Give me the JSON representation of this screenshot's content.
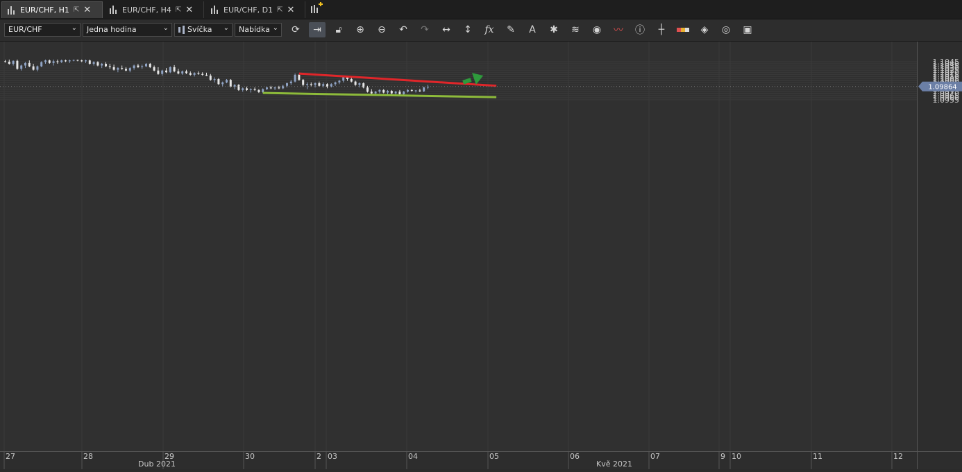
{
  "tabs": [
    {
      "label": "EUR/CHF, H1",
      "active": true
    },
    {
      "label": "EUR/CHF, H4",
      "active": false
    },
    {
      "label": "EUR/CHF, D1",
      "active": false
    }
  ],
  "toolbar": {
    "instrument": "EUR/CHF",
    "period": "Jedna hodina",
    "chart_type": "Svíčka",
    "offer_side": "Nabídka",
    "icons": [
      "refresh-icon",
      "shift-chart-icon",
      "unlock-icon",
      "zoom-in-icon",
      "zoom-out-icon",
      "undo-icon",
      "redo-icon",
      "horizontal-arrows-icon",
      "vertical-arrows-icon",
      "fx-indicators-icon",
      "pencil-draw-icon",
      "text-tool-icon",
      "pattern-icon",
      "layers-icon",
      "eye-icon",
      "chart-signals-icon",
      "info-icon",
      "crosshair-icon",
      "theme-icon",
      "paint-bucket-icon",
      "circular-icon",
      "save-icon"
    ]
  },
  "colors": {
    "background": "#303030",
    "bull_candle": "#8fa3c4",
    "bear_candle": "#e6e6e6",
    "resistance_line": "#e0262a",
    "support_line": "#8dbb3a",
    "arrow": "#2e9a3c",
    "price_marker": "#6b7fa6"
  },
  "price_axis": {
    "labels": [
      "1.1045",
      "1.1040",
      "1.1035",
      "1.1030",
      "1.1025",
      "1.1020",
      "1.1015",
      "1.1010",
      "1.1005",
      "1.1000",
      "1.0995",
      "1.0990",
      "1.0985",
      "1.0980",
      "1.0975",
      "1.0970",
      "1.0965",
      "1.0960",
      "1.0955"
    ],
    "current_price": "1.09864"
  },
  "time_axis": {
    "labels": [
      "27",
      "28",
      "29",
      "30",
      "2",
      "03",
      "04",
      "05",
      "06",
      "07",
      "9",
      "10",
      "11",
      "12"
    ],
    "month_labels": [
      "Dub 2021",
      "Kvě 2021"
    ]
  },
  "chart_data": {
    "type": "candlestick",
    "instrument": "EUR/CHF",
    "period": "H1",
    "ylim": [
      1.095,
      1.105
    ],
    "grid": true,
    "candles": [
      [
        1.1046,
        1.1049,
        1.1043,
        1.1045
      ],
      [
        1.1045,
        1.105,
        1.1038,
        1.104
      ],
      [
        1.104,
        1.1048,
        1.1036,
        1.1047
      ],
      [
        1.1047,
        1.105,
        1.1026,
        1.1028
      ],
      [
        1.1028,
        1.1038,
        1.1024,
        1.1036
      ],
      [
        1.1036,
        1.1044,
        1.103,
        1.1042
      ],
      [
        1.1042,
        1.1048,
        1.1032,
        1.1034
      ],
      [
        1.1034,
        1.104,
        1.1024,
        1.1026
      ],
      [
        1.1026,
        1.1036,
        1.1022,
        1.1034
      ],
      [
        1.1034,
        1.1046,
        1.1032,
        1.1044
      ],
      [
        1.1044,
        1.105,
        1.104,
        1.1048
      ],
      [
        1.1048,
        1.105,
        1.104,
        1.1042
      ],
      [
        1.1042,
        1.105,
        1.1036,
        1.1046
      ],
      [
        1.1046,
        1.105,
        1.104,
        1.1044
      ],
      [
        1.1044,
        1.105,
        1.1042,
        1.1048
      ],
      [
        1.1048,
        1.105,
        1.1044,
        1.1046
      ],
      [
        1.1046,
        1.105,
        1.1042,
        1.1048
      ],
      [
        1.1048,
        1.105,
        1.1046,
        1.1049
      ],
      [
        1.1049,
        1.105,
        1.1046,
        1.1048
      ],
      [
        1.1048,
        1.105,
        1.1044,
        1.1046
      ],
      [
        1.1046,
        1.105,
        1.1042,
        1.1048
      ],
      [
        1.1048,
        1.105,
        1.1038,
        1.104
      ],
      [
        1.104,
        1.1046,
        1.1036,
        1.1044
      ],
      [
        1.1044,
        1.1046,
        1.1034,
        1.1036
      ],
      [
        1.1036,
        1.1042,
        1.103,
        1.104
      ],
      [
        1.104,
        1.1044,
        1.1032,
        1.1034
      ],
      [
        1.1034,
        1.104,
        1.1028,
        1.1032
      ],
      [
        1.1032,
        1.1038,
        1.1024,
        1.1026
      ],
      [
        1.1026,
        1.1032,
        1.102,
        1.103
      ],
      [
        1.103,
        1.1036,
        1.1026,
        1.1028
      ],
      [
        1.1028,
        1.1032,
        1.1022,
        1.1024
      ],
      [
        1.1024,
        1.1032,
        1.102,
        1.103
      ],
      [
        1.103,
        1.1038,
        1.1026,
        1.1036
      ],
      [
        1.1036,
        1.104,
        1.103,
        1.1032
      ],
      [
        1.1032,
        1.1038,
        1.1028,
        1.1034
      ],
      [
        1.1034,
        1.1042,
        1.1032,
        1.104
      ],
      [
        1.104,
        1.1042,
        1.103,
        1.1032
      ],
      [
        1.1032,
        1.1036,
        1.1022,
        1.1024
      ],
      [
        1.1024,
        1.1032,
        1.1014,
        1.1016
      ],
      [
        1.1016,
        1.1026,
        1.1012,
        1.1024
      ],
      [
        1.1024,
        1.103,
        1.1018,
        1.102
      ],
      [
        1.102,
        1.1034,
        1.1018,
        1.1032
      ],
      [
        1.1032,
        1.1037,
        1.102,
        1.1022
      ],
      [
        1.1022,
        1.1028,
        1.1015,
        1.1017
      ],
      [
        1.1017,
        1.1024,
        1.1014,
        1.1022
      ],
      [
        1.1022,
        1.1026,
        1.1016,
        1.1018
      ],
      [
        1.1018,
        1.1022,
        1.1012,
        1.1014
      ],
      [
        1.1014,
        1.102,
        1.101,
        1.1018
      ],
      [
        1.1018,
        1.1022,
        1.1014,
        1.1016
      ],
      [
        1.1016,
        1.102,
        1.1012,
        1.1014
      ],
      [
        1.1014,
        1.1019,
        1.1011,
        1.1012
      ],
      [
        1.1012,
        1.1016,
        1.1,
        1.1002
      ],
      [
        1.1002,
        1.1008,
        1.0996,
        1.1004
      ],
      [
        1.1004,
        1.1006,
        1.099,
        1.0992
      ],
      [
        1.0992,
        1.0998,
        1.0986,
        1.0996
      ],
      [
        1.0996,
        1.1004,
        1.0994,
        1.1002
      ],
      [
        1.1002,
        1.1004,
        1.0984,
        1.0986
      ],
      [
        1.0986,
        1.0992,
        1.098,
        1.099
      ],
      [
        1.099,
        1.0992,
        1.0976,
        1.0978
      ],
      [
        1.0978,
        1.0984,
        1.0974,
        1.0982
      ],
      [
        1.0982,
        1.0986,
        1.0976,
        1.0978
      ],
      [
        1.0978,
        1.0982,
        1.0972,
        1.098
      ],
      [
        1.098,
        1.0984,
        1.0976,
        1.0978
      ],
      [
        1.0978,
        1.098,
        1.0971,
        1.0973
      ],
      [
        1.0973,
        1.0982,
        1.0971,
        1.098
      ],
      [
        1.098,
        1.0986,
        1.0978,
        1.0984
      ],
      [
        1.0984,
        1.0988,
        1.098,
        1.0982
      ],
      [
        1.0982,
        1.0986,
        1.0978,
        1.0984
      ],
      [
        1.0984,
        1.0988,
        1.098,
        1.0982
      ],
      [
        1.0982,
        1.099,
        1.098,
        1.0988
      ],
      [
        1.0988,
        1.0996,
        1.0984,
        1.0994
      ],
      [
        1.0994,
        1.1002,
        1.099,
        1.0998
      ],
      [
        1.0998,
        1.1017,
        1.0996,
        1.1014
      ],
      [
        1.1014,
        1.1016,
        1.1,
        1.1002
      ],
      [
        1.1002,
        1.1004,
        1.0986,
        1.099
      ],
      [
        1.099,
        1.0996,
        1.098,
        1.0992
      ],
      [
        1.0992,
        1.0996,
        1.0986,
        1.099
      ],
      [
        1.099,
        1.0996,
        1.0984,
        1.0994
      ],
      [
        1.0994,
        1.0998,
        1.0986,
        1.0988
      ],
      [
        1.0988,
        1.0996,
        1.0984,
        1.0992
      ],
      [
        1.0992,
        1.0994,
        1.0982,
        1.0986
      ],
      [
        1.0986,
        1.0994,
        1.0984,
        1.0992
      ],
      [
        1.0992,
        1.0998,
        1.0988,
        1.0996
      ],
      [
        1.0996,
        1.1002,
        1.0992,
        1.1
      ],
      [
        1.1,
        1.101,
        1.0996,
        1.1008
      ],
      [
        1.1008,
        1.1011,
        1.1,
        1.1004
      ],
      [
        1.1004,
        1.1008,
        1.0996,
        1.0998
      ],
      [
        1.0998,
        1.1,
        1.0988,
        1.099
      ],
      [
        1.099,
        1.0996,
        1.0984,
        1.0994
      ],
      [
        1.0994,
        1.0996,
        1.0982,
        1.0984
      ],
      [
        1.0984,
        1.0988,
        1.0972,
        1.0974
      ],
      [
        1.0974,
        1.098,
        1.0968,
        1.097
      ],
      [
        1.097,
        1.0976,
        1.0966,
        1.0974
      ],
      [
        1.0974,
        1.098,
        1.097,
        1.0978
      ],
      [
        1.0978,
        1.098,
        1.097,
        1.0972
      ],
      [
        1.0972,
        1.0978,
        1.0966,
        1.0976
      ],
      [
        1.0976,
        1.0978,
        1.0968,
        1.097
      ],
      [
        1.097,
        1.0976,
        1.0966,
        1.0974
      ],
      [
        1.0974,
        1.0978,
        1.0966,
        1.0968
      ],
      [
        1.0968,
        1.0976,
        1.0966,
        1.0974
      ],
      [
        1.0974,
        1.098,
        1.0972,
        1.0978
      ],
      [
        1.0978,
        1.098,
        1.0974,
        1.0976
      ],
      [
        1.0976,
        1.0978,
        1.0972,
        1.0977
      ],
      [
        1.0977,
        1.0981,
        1.0973,
        1.0975
      ],
      [
        1.0975,
        1.0986,
        1.0973,
        1.0984
      ],
      [
        1.0984,
        1.099,
        1.098,
        1.0986
      ]
    ],
    "trendlines": [
      {
        "name": "resistance",
        "from": {
          "candle": 73,
          "price": 1.1017
        },
        "to": {
          "candle": 122,
          "price": 1.0988
        }
      },
      {
        "name": "support",
        "from": {
          "candle": 64,
          "price": 1.0971
        },
        "to": {
          "candle": 122,
          "price": 1.0961
        }
      }
    ],
    "arrow": {
      "from": {
        "candle": 114,
        "price": 1.0996
      },
      "to": {
        "candle": 119,
        "price": 1.1012
      }
    }
  }
}
